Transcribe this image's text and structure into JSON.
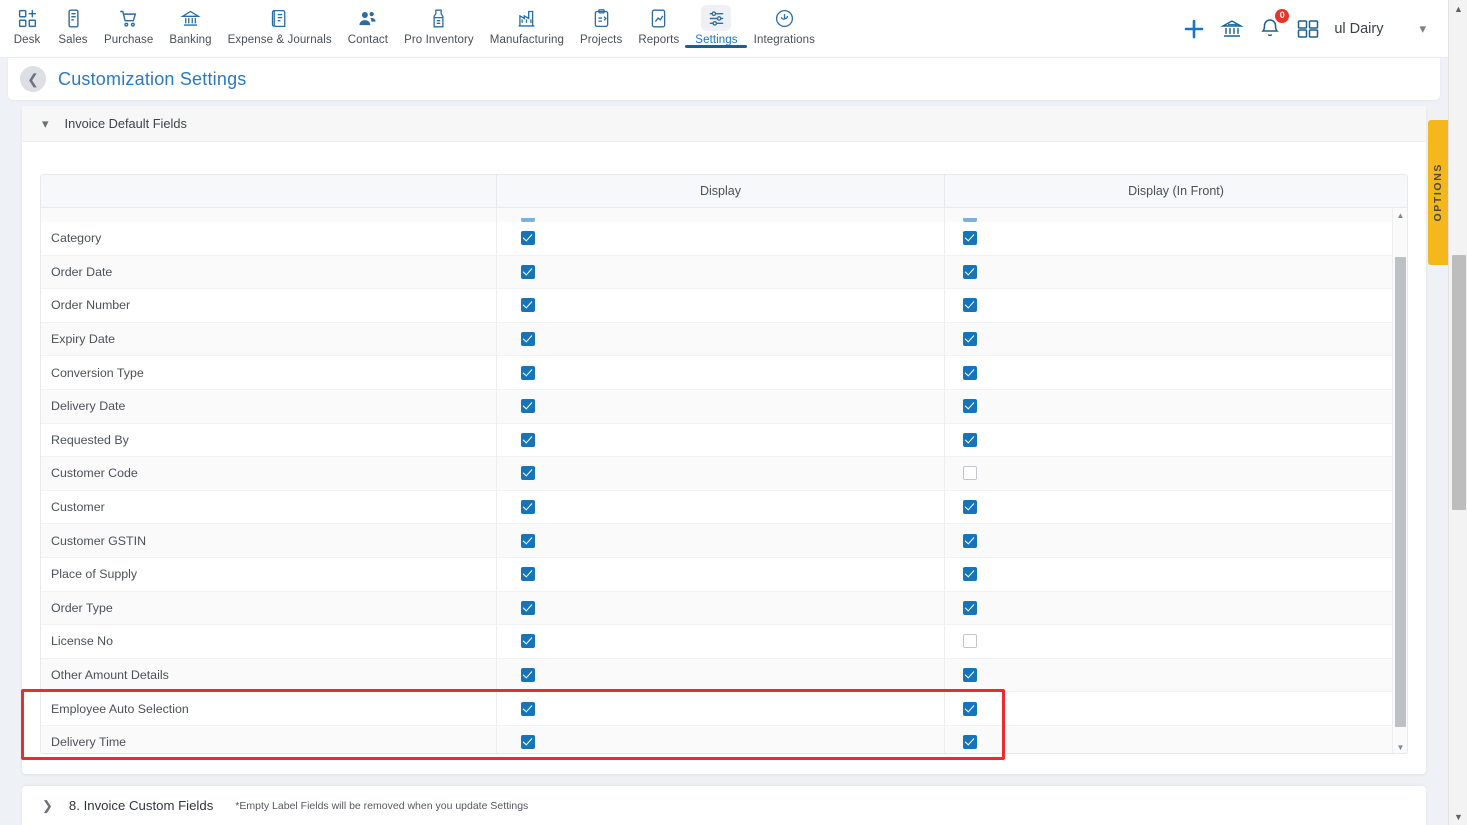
{
  "topnav": {
    "items": [
      {
        "label": "Desk",
        "icon": "desk-grid-plus-icon",
        "active": false
      },
      {
        "label": "Sales",
        "icon": "sales-receipt-icon",
        "active": false
      },
      {
        "label": "Purchase",
        "icon": "purchase-cart-icon",
        "active": false
      },
      {
        "label": "Banking",
        "icon": "banking-bank-icon",
        "active": false
      },
      {
        "label": "Expense & Journals",
        "icon": "expense-journal-icon",
        "active": false
      },
      {
        "label": "Contact",
        "icon": "contact-people-icon",
        "active": false
      },
      {
        "label": "Pro Inventory",
        "icon": "pro-inventory-icon",
        "active": false
      },
      {
        "label": "Manufacturing",
        "icon": "manufacturing-factory-icon",
        "active": false
      },
      {
        "label": "Projects",
        "icon": "projects-clipboard-icon",
        "active": false
      },
      {
        "label": "Reports",
        "icon": "reports-chart-icon",
        "active": false
      },
      {
        "label": "Settings",
        "icon": "settings-sliders-icon",
        "active": true
      },
      {
        "label": "Integrations",
        "icon": "integrations-plug-icon",
        "active": false
      }
    ],
    "right": {
      "add_icon": "plus-icon",
      "transfer_icon": "bank-transfer-icon",
      "bell_icon": "notification-bell-icon",
      "notification_count": "0",
      "apps_icon": "apps-grid-icon",
      "org_name": "ul Dairy",
      "chevron_icon": "chevron-down-icon"
    },
    "accent_color": "#1a73c4"
  },
  "pageheader": {
    "back_icon": "back-chevron-icon",
    "title": "Customization Settings"
  },
  "section": {
    "chevron_icon": "chevron-down-icon",
    "title": "Invoice Default Fields"
  },
  "table": {
    "columns": [
      "",
      "Display",
      "Display (In Front)"
    ],
    "rows": [
      {
        "label": "Category",
        "display": true,
        "front": true
      },
      {
        "label": "Order Date",
        "display": true,
        "front": true
      },
      {
        "label": "Order Number",
        "display": true,
        "front": true
      },
      {
        "label": "Expiry Date",
        "display": true,
        "front": true
      },
      {
        "label": "Conversion Type",
        "display": true,
        "front": true
      },
      {
        "label": "Delivery Date",
        "display": true,
        "front": true
      },
      {
        "label": "Requested By",
        "display": true,
        "front": true
      },
      {
        "label": "Customer Code",
        "display": true,
        "front": false
      },
      {
        "label": "Customer",
        "display": true,
        "front": true
      },
      {
        "label": "Customer GSTIN",
        "display": true,
        "front": true
      },
      {
        "label": "Place of Supply",
        "display": true,
        "front": true
      },
      {
        "label": "Order Type",
        "display": true,
        "front": true
      },
      {
        "label": "License No",
        "display": true,
        "front": false
      },
      {
        "label": "Other Amount Details",
        "display": true,
        "front": true
      },
      {
        "label": "Employee Auto Selection",
        "display": true,
        "front": true
      },
      {
        "label": "Delivery Time",
        "display": true,
        "front": true
      }
    ],
    "scrollbar": {
      "up_arrow_icon": "scroll-up-arrow-icon",
      "down_arrow_icon": "scroll-down-arrow-icon"
    }
  },
  "annotation": {
    "highlight_color": "#ee2b2b"
  },
  "bottom": {
    "chevron_icon": "chevron-right-icon",
    "title": "8. Invoice Custom Fields",
    "note": "*Empty Label Fields will be removed when you update Settings"
  },
  "options_tab": {
    "label": "OPTIONS",
    "color": "#f5b81c"
  },
  "outer_scrollbar": {
    "up_arrow_icon": "scroll-up-arrow-icon",
    "down_arrow_icon": "scroll-down-arrow-icon"
  }
}
